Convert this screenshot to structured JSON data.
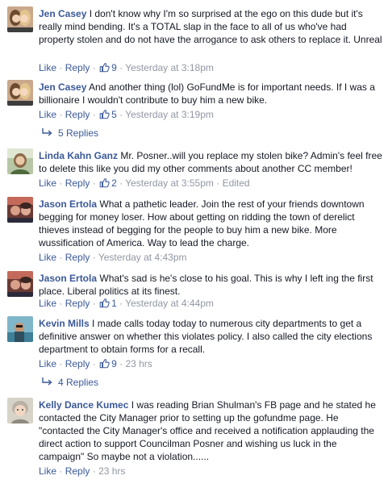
{
  "colors": {
    "link": "#3b5998",
    "text": "#141823",
    "meta": "#9197a3",
    "background": "#ffffff"
  },
  "icons": {
    "like": "thumbs-up-icon",
    "reply_arrow": "reply-arrow-icon"
  },
  "actions": {
    "like": "Like",
    "reply": "Reply",
    "dot": "·"
  },
  "comments": [
    {
      "author": "Jen Casey",
      "text": "I don't know why I'm so surprised at the ego on this dude but it's really mind bending. It's a TOTAL slap in the face to all of us who've had property stolen and do not have the arrogance to ask others to replace it. Unreal",
      "likes": "9",
      "timestamp": "Yesterday at 3:18pm"
    },
    {
      "author": "Jen Casey",
      "text": "And another thing (lol) GoFundMe is for important needs. If I was a billionaire I wouldn't contribute to buy him a new bike.",
      "likes": "5",
      "timestamp": "Yesterday at 3:19pm",
      "replies": "5 Replies"
    },
    {
      "author": "Linda Kahn Ganz",
      "text": "Mr. Posner..will you replace my stolen bike? Admin's feel free to delete this like you did my other comments about another CC member!",
      "likes": "2",
      "timestamp": "Yesterday at 3:55pm",
      "edited": "Edited"
    },
    {
      "author": "Jason Ertola",
      "text": "What a pathetic leader. Join the rest of your friends downtown begging for money loser. How about getting on ridding the town of derelict thieves instead of begging for the people to buy him a new bike. More wussification of America. Way to lead the charge.",
      "timestamp": "Yesterday at 4:43pm"
    },
    {
      "author": "Jason Ertola",
      "text": "What's sad is he's close to his goal. This is why I left ing the first place. Liberal politics at its finest.",
      "likes": "1",
      "timestamp": "Yesterday at 4:44pm"
    },
    {
      "author": "Kevin Mills",
      "text": "I made calls today today to numerous city departments to get a definitive answer on whether this violates policy. I also called the city elections department to obtain forms for a recall.",
      "likes": "9",
      "timestamp": "23 hrs",
      "replies": "4 Replies"
    },
    {
      "author": "Kelly Dance Kumec",
      "text": "I was reading Brian Shulman's FB page and he stated he contacted the City Manager prior to setting up the gofundme page. He \"contacted the City Manager's office and received a notification applauding the direct action to support Councilman Posner and wishing us luck in the campaign\" So maybe not a violation......",
      "timestamp": "23 hrs"
    }
  ]
}
